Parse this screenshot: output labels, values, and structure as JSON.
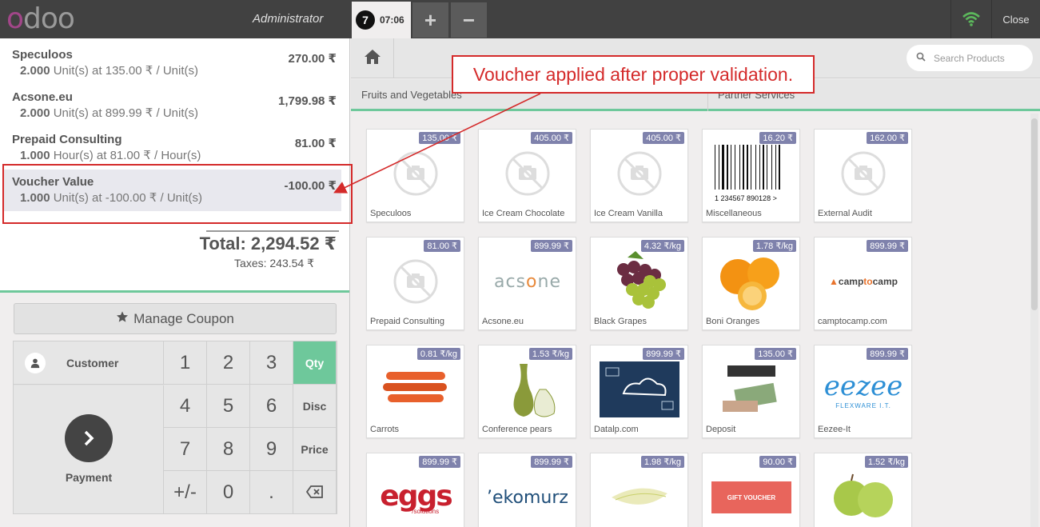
{
  "header": {
    "logo_text": "odoo",
    "user": "Administrator",
    "order_number": "7",
    "order_time": "07:06",
    "add_order_label": "+",
    "remove_order_label": "−",
    "close_label": "Close",
    "accent_color": "#6ec89b"
  },
  "order": {
    "lines": [
      {
        "name": "Speculoos",
        "price": "270.00 ₹",
        "qty": "2.000",
        "info": "Unit(s) at 135.00 ₹ / Unit(s)"
      },
      {
        "name": "Acsone.eu",
        "price": "1,799.98 ₹",
        "qty": "2.000",
        "info": "Unit(s) at 899.99 ₹ / Unit(s)"
      },
      {
        "name": "Prepaid Consulting",
        "price": "81.00 ₹",
        "qty": "1.000",
        "info": "Hour(s) at 81.00 ₹ / Hour(s)"
      },
      {
        "name": "Voucher Value",
        "price": "-100.00 ₹",
        "qty": "1.000",
        "info": "Unit(s) at -100.00 ₹ / Unit(s)"
      }
    ],
    "total": "Total: 2,294.52 ₹",
    "taxes": "Taxes: 243.54 ₹"
  },
  "coupon": {
    "label": "Manage Coupon"
  },
  "pad": {
    "customer_label": "Customer",
    "payment_label": "Payment",
    "keys": [
      "1",
      "2",
      "3",
      "Qty",
      "4",
      "5",
      "6",
      "Disc",
      "7",
      "8",
      "9",
      "Price",
      "+/-",
      "0",
      ".",
      "⌫"
    ]
  },
  "products_pane": {
    "search_placeholder": "Search Products",
    "categories": [
      "Fruits and Vegetables",
      "Partner Services"
    ],
    "products": [
      {
        "name": "Speculoos",
        "price": "135.00 ₹",
        "icon": "no-image-icon"
      },
      {
        "name": "Ice Cream Chocolate",
        "price": "405.00 ₹",
        "icon": "no-image-icon"
      },
      {
        "name": "Ice Cream Vanilla",
        "price": "405.00 ₹",
        "icon": "no-image-icon"
      },
      {
        "name": "Miscellaneous",
        "price": "16.20 ₹",
        "icon": "barcode-image",
        "barcode_text": "1 234567 890128 >"
      },
      {
        "name": "External Audit",
        "price": "162.00 ₹",
        "icon": "no-image-icon"
      },
      {
        "name": "Prepaid Consulting",
        "price": "81.00 ₹",
        "icon": "no-image-icon"
      },
      {
        "name": "Acsone.eu",
        "price": "899.99 ₹",
        "icon": "acsone-logo",
        "logo_text": "acsone"
      },
      {
        "name": "Black Grapes",
        "price": "4.32 ₹/kg",
        "icon": "grapes-image"
      },
      {
        "name": "Boni Oranges",
        "price": "1.78 ₹/kg",
        "icon": "oranges-image"
      },
      {
        "name": "camptocamp.com",
        "price": "899.99 ₹",
        "icon": "camptocamp-logo",
        "logo_text": "camptocamp"
      },
      {
        "name": "Carrots",
        "price": "0.81 ₹/kg",
        "icon": "carrots-image"
      },
      {
        "name": "Conference pears",
        "price": "1.53 ₹/kg",
        "icon": "pears-image"
      },
      {
        "name": "Datalp.com",
        "price": "899.99 ₹",
        "icon": "datalp-image"
      },
      {
        "name": "Deposit",
        "price": "135.00 ₹",
        "icon": "deposit-image"
      },
      {
        "name": "Eezee-It",
        "price": "899.99 ₹",
        "icon": "eezee-logo",
        "logo_text": "eezee",
        "logo_sub": "FLEXWARE I.T."
      },
      {
        "name": "",
        "price": "899.99 ₹",
        "icon": "eggs-logo",
        "logo_text": "eggs",
        "logo_sub": "solutions"
      },
      {
        "name": "",
        "price": "899.99 ₹",
        "icon": "ekomurz-logo",
        "logo_text": "ekomurz"
      },
      {
        "name": "",
        "price": "1.98 ₹/kg",
        "icon": "endive-image"
      },
      {
        "name": "",
        "price": "90.00 ₹",
        "icon": "gift-voucher-image",
        "logo_text": "GIFT VOUCHER"
      },
      {
        "name": "",
        "price": "1.52 ₹/kg",
        "icon": "apples-image"
      }
    ]
  },
  "annotation": {
    "text": "Voucher applied after proper validation.",
    "color": "#d42a2a"
  }
}
